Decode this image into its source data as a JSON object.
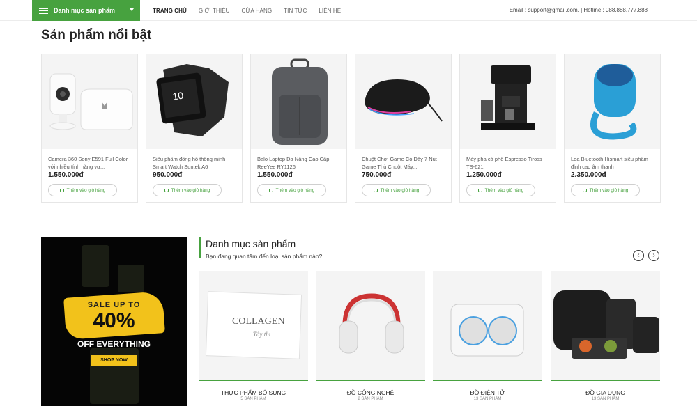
{
  "header": {
    "category_button": "Danh mục sản phẩm",
    "nav": [
      "TRANG CHỦ",
      "GIỚI THIỆU",
      "CỬA HÀNG",
      "TIN TỨC",
      "LIÊN HỆ"
    ],
    "contact": "Email : support@gmail.com. | Hotline : 088.888.777.888"
  },
  "featured": {
    "title": "Sản phẩm nổi bật",
    "add_to_cart": "Thêm vào giỏ hàng",
    "products": [
      {
        "name": "Camera 360 Sony E591 Full Color với nhiều tính năng vư...",
        "price": "1.550.000đ",
        "icon": "security-camera-image"
      },
      {
        "name": "Siêu phẩm đồng hồ thông minh Smart Watch Suntek A6",
        "price": "950.000đ",
        "icon": "smart-watch-image"
      },
      {
        "name": "Balo Laptop Đa Năng Cao Cấp ReeYee RY1126",
        "price": "1.550.000đ",
        "icon": "backpack-image"
      },
      {
        "name": "Chuột Chơi Game Có Dây 7 Nút Game Thủ Chuột Máy...",
        "price": "750.000đ",
        "icon": "gaming-mouse-image"
      },
      {
        "name": "Máy pha cà phê Espresso Tiross TS-621",
        "price": "1.250.000đ",
        "icon": "espresso-machine-image"
      },
      {
        "name": "Loa Bluetooth Hismart siêu phẩm đỉnh cao âm thanh",
        "price": "2.350.000đ",
        "icon": "bluetooth-speaker-image"
      }
    ]
  },
  "promo": {
    "line1": "SALE UP TO",
    "line2": "40%",
    "line3": "OFF EVERYTHING",
    "button": "SHOP NOW"
  },
  "categories": {
    "title": "Danh mục sản phẩm",
    "subtitle": "Bạn đang quan tâm đến loại sản phẩm nào?",
    "prev": "‹",
    "next": "›",
    "items": [
      {
        "name": "THỰC PHẨM BỔ SUNG",
        "count": "5 SẢN PHẨM",
        "image_text": "COLLAGEN",
        "image_subtext": "Tây thi"
      },
      {
        "name": "ĐỒ CÔNG NGHỆ",
        "count": "2 SẢN PHẨM"
      },
      {
        "name": "ĐỒ ĐIỆN TỬ",
        "count": "13 SẢN PHẨM"
      },
      {
        "name": "ĐỒ GIA DỤNG",
        "count": "13 SẢN PHẨM"
      }
    ]
  },
  "colors": {
    "accent": "#47a23f",
    "promo_yellow": "#f2c21b"
  }
}
